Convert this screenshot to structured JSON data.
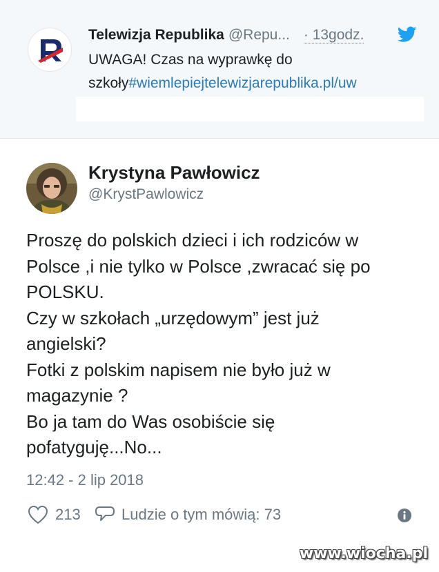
{
  "quoted_tweet": {
    "author_name": "Telewizja Republika",
    "author_handle": "@Repu...",
    "time": "· 13godz.",
    "text_line1": "UWAGA! Czas na wyprawkę do",
    "text_line2_prefix": "szkoły",
    "text_link": "#wiemlepiejtelewizjarepublika.pl/uw",
    "avatar_logo_letter": "R",
    "brand_colors": {
      "twitter_blue": "#1da1f2",
      "logo_navy": "#1a2a6c",
      "logo_red": "#d7262e"
    }
  },
  "tweet": {
    "author_name": "Krystyna Pawłowicz",
    "author_handle": "@KrystPawlowicz",
    "body_lines": [
      "Proszę do polskich dzieci i ich rodziców w",
      "Polsce ,i nie tylko w Polsce ,zwracać się po",
      "POLSKU.",
      "Czy w szkołach „urzędowym” jest już",
      "angielski?",
      "Fotki z polskim napisem nie było już w",
      "magazynie ?",
      "Bo ja tam do Was osobiście się",
      "pofatyguję...No..."
    ],
    "timestamp": "12:42 - 2 lip 2018",
    "likes": "213",
    "replies_label": "Ludzie o tym mówią: 73"
  },
  "icons": {
    "bird": "twitter-bird-icon",
    "heart": "heart-icon",
    "reply": "reply-bubble-icon",
    "info": "info-icon"
  },
  "watermark": "www.wiocha.pl"
}
